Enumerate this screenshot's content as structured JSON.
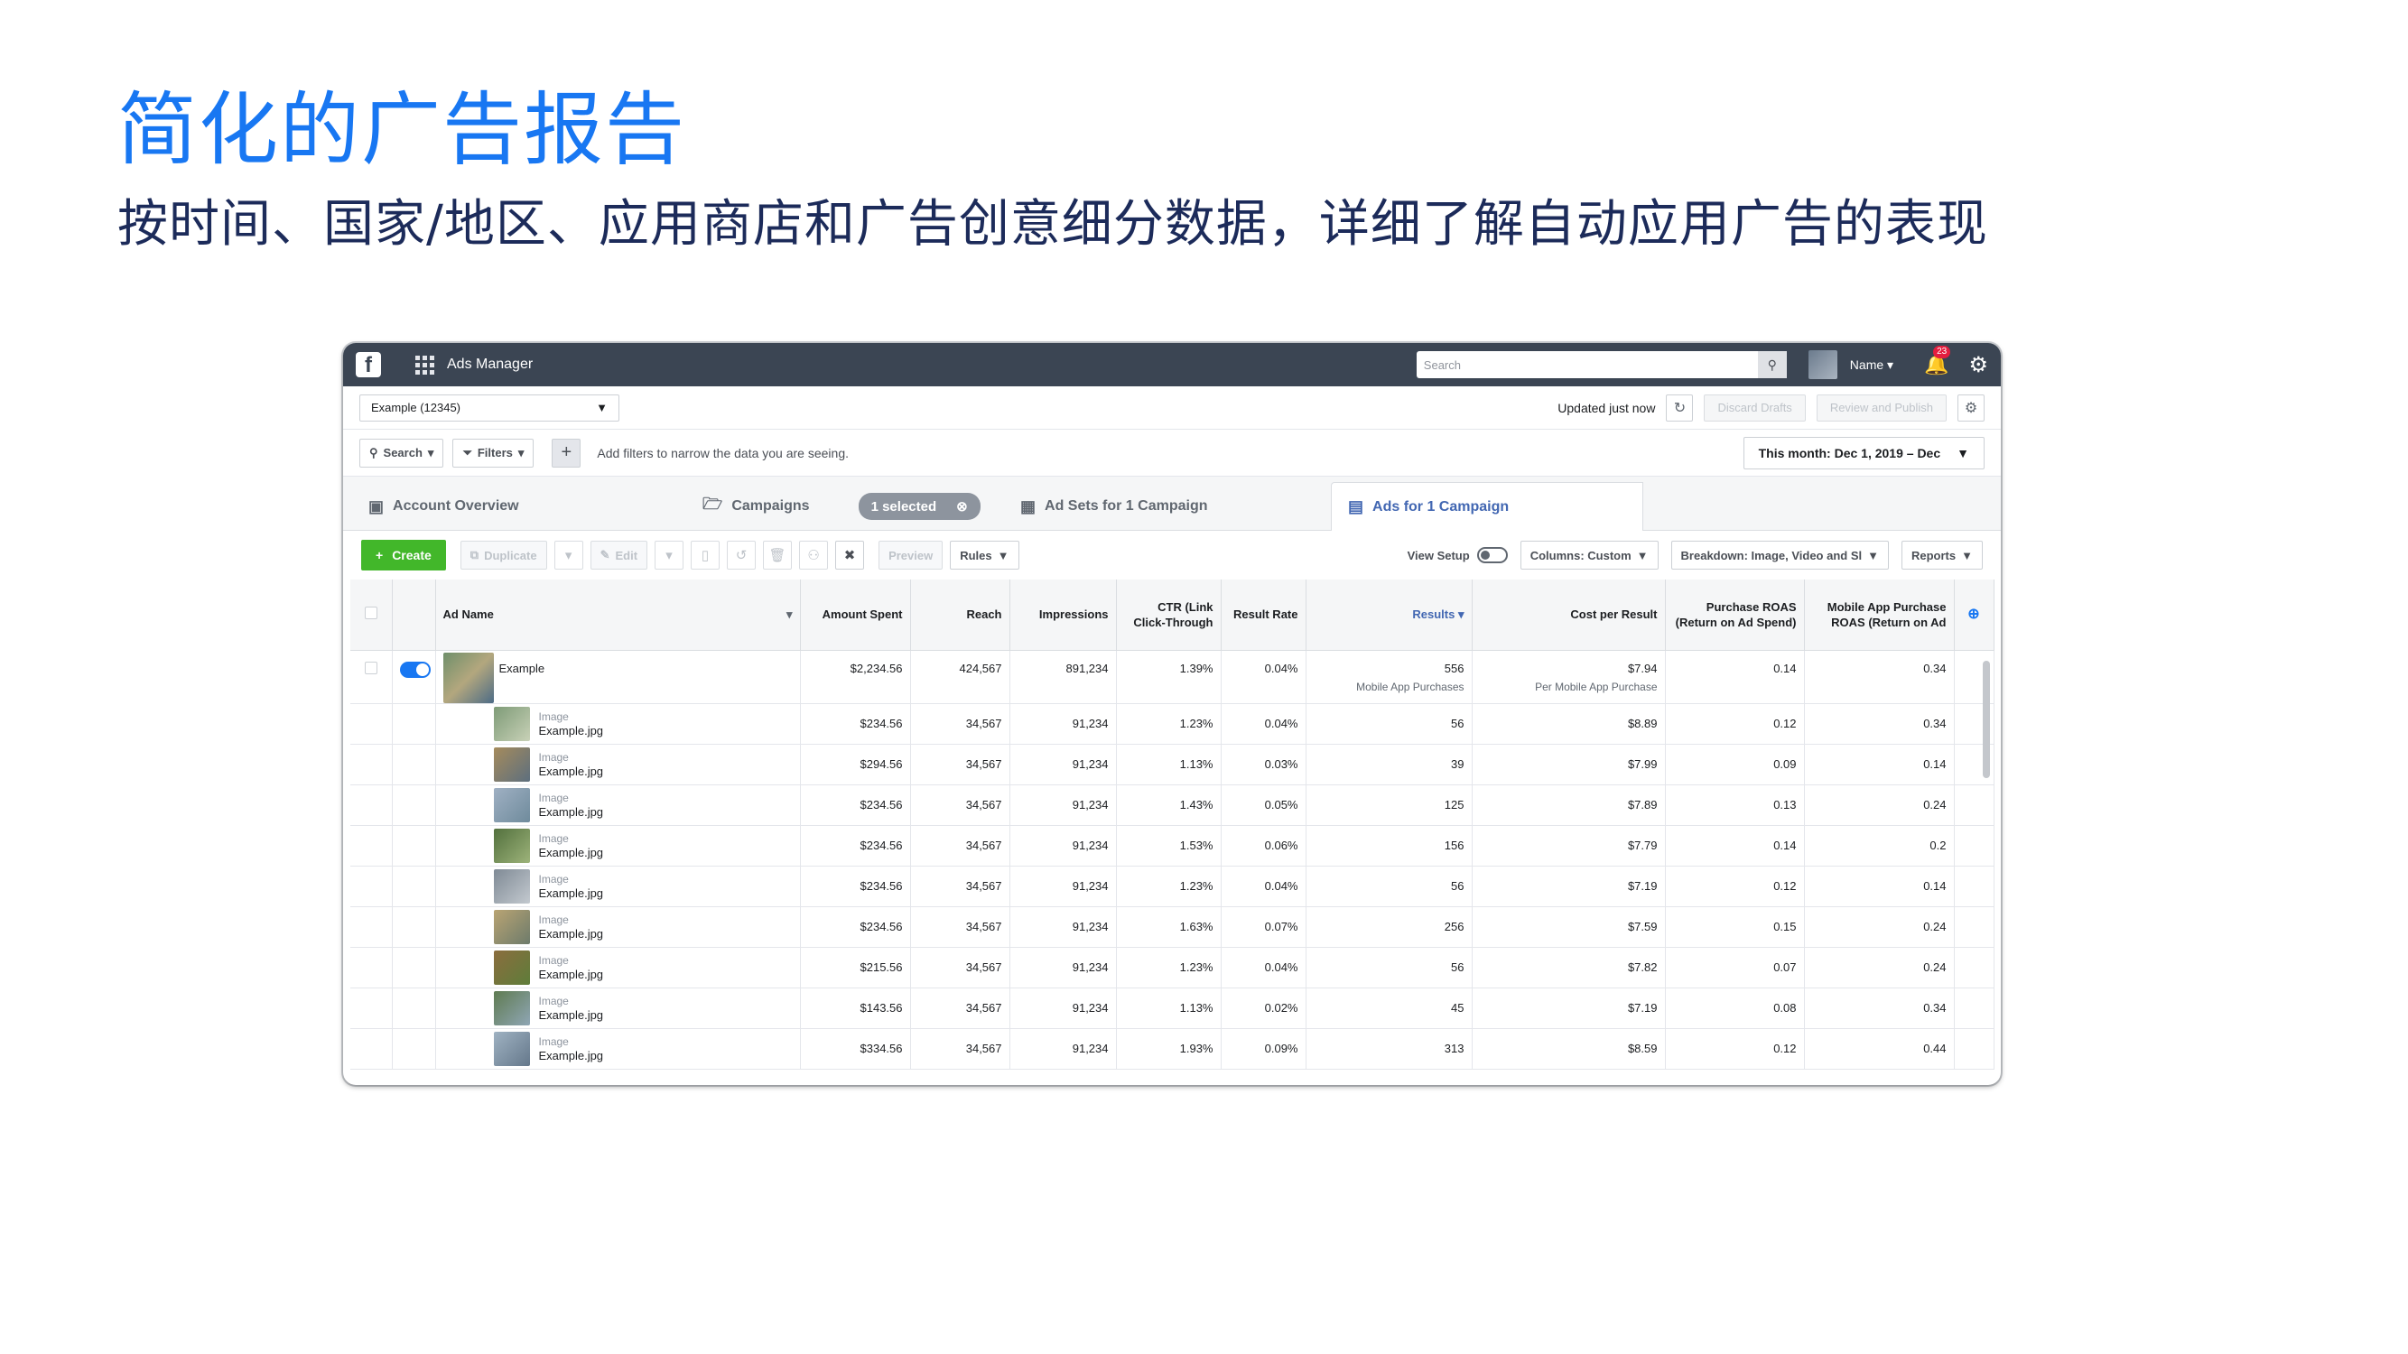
{
  "hero": {
    "title": "简化的广告报告",
    "subtitle": "按时间、国家/地区、应用商店和广告创意细分数据，详细了解自动应用广告的表现"
  },
  "topbar": {
    "logo": "f",
    "app_name": "Ads Manager",
    "search_placeholder": "Search",
    "user_name": "Name",
    "notification_count": "23"
  },
  "account_bar": {
    "account": "Example (12345)",
    "updated": "Updated just now",
    "discard": "Discard Drafts",
    "review": "Review and Publish"
  },
  "filter_bar": {
    "search": "Search",
    "filters": "Filters",
    "hint": "Add filters to narrow the data you are seeing.",
    "date_range": "This month: Dec 1, 2019 – Dec"
  },
  "tabs": [
    {
      "label": "Account Overview"
    },
    {
      "label": "Campaigns",
      "pill": "1 selected"
    },
    {
      "label": "Ad Sets for 1 Campaign"
    },
    {
      "label": "Ads for 1 Campaign"
    }
  ],
  "toolbar": {
    "create": "Create",
    "duplicate": "Duplicate",
    "edit": "Edit",
    "preview": "Preview",
    "rules": "Rules",
    "view_setup": "View Setup",
    "columns": "Columns: Custom",
    "breakdown": "Breakdown: Image, Video and Sl",
    "reports": "Reports"
  },
  "table": {
    "headers": {
      "name": "Ad Name",
      "spent": "Amount Spent",
      "reach": "Reach",
      "impressions": "Impressions",
      "ctr": "CTR (Link Click-Through",
      "rate": "Result Rate",
      "results": "Results",
      "cpr": "Cost per Result",
      "roas": "Purchase ROAS (Return on Ad Spend)",
      "mroas": "Mobile App Purchase ROAS (Return on Ad"
    },
    "parent": {
      "name": "Example",
      "spent": "$2,234.56",
      "reach": "424,567",
      "impressions": "891,234",
      "ctr": "1.39%",
      "rate": "0.04%",
      "results": "556",
      "results_sub": "Mobile App Purchases",
      "cpr": "$7.94",
      "cpr_sub": "Per Mobile App Purchase",
      "roas": "0.14",
      "mroas": "0.34"
    },
    "rows": [
      {
        "type": "Image",
        "file": "Example.jpg",
        "spent": "$234.56",
        "reach": "34,567",
        "impressions": "91,234",
        "ctr": "1.23%",
        "rate": "0.04%",
        "results": "56",
        "cpr": "$8.89",
        "roas": "0.12",
        "mroas": "0.34"
      },
      {
        "type": "Image",
        "file": "Example.jpg",
        "spent": "$294.56",
        "reach": "34,567",
        "impressions": "91,234",
        "ctr": "1.13%",
        "rate": "0.03%",
        "results": "39",
        "cpr": "$7.99",
        "roas": "0.09",
        "mroas": "0.14"
      },
      {
        "type": "Image",
        "file": "Example.jpg",
        "spent": "$234.56",
        "reach": "34,567",
        "impressions": "91,234",
        "ctr": "1.43%",
        "rate": "0.05%",
        "results": "125",
        "cpr": "$7.89",
        "roas": "0.13",
        "mroas": "0.24"
      },
      {
        "type": "Image",
        "file": "Example.jpg",
        "spent": "$234.56",
        "reach": "34,567",
        "impressions": "91,234",
        "ctr": "1.53%",
        "rate": "0.06%",
        "results": "156",
        "cpr": "$7.79",
        "roas": "0.14",
        "mroas": "0.2"
      },
      {
        "type": "Image",
        "file": "Example.jpg",
        "spent": "$234.56",
        "reach": "34,567",
        "impressions": "91,234",
        "ctr": "1.23%",
        "rate": "0.04%",
        "results": "56",
        "cpr": "$7.19",
        "roas": "0.12",
        "mroas": "0.14"
      },
      {
        "type": "Image",
        "file": "Example.jpg",
        "spent": "$234.56",
        "reach": "34,567",
        "impressions": "91,234",
        "ctr": "1.63%",
        "rate": "0.07%",
        "results": "256",
        "cpr": "$7.59",
        "roas": "0.15",
        "mroas": "0.24"
      },
      {
        "type": "Image",
        "file": "Example.jpg",
        "spent": "$215.56",
        "reach": "34,567",
        "impressions": "91,234",
        "ctr": "1.23%",
        "rate": "0.04%",
        "results": "56",
        "cpr": "$7.82",
        "roas": "0.07",
        "mroas": "0.24"
      },
      {
        "type": "Image",
        "file": "Example.jpg",
        "spent": "$143.56",
        "reach": "34,567",
        "impressions": "91,234",
        "ctr": "1.13%",
        "rate": "0.02%",
        "results": "45",
        "cpr": "$7.19",
        "roas": "0.08",
        "mroas": "0.34"
      },
      {
        "type": "Image",
        "file": "Example.jpg",
        "spent": "$334.56",
        "reach": "34,567",
        "impressions": "91,234",
        "ctr": "1.93%",
        "rate": "0.09%",
        "results": "313",
        "cpr": "$8.59",
        "roas": "0.12",
        "mroas": "0.44"
      }
    ]
  },
  "colors": {
    "brand_blue": "#1877f2",
    "topbar": "#3b4553",
    "create_green": "#42b72a",
    "subtitle": "#1c2b5a"
  }
}
